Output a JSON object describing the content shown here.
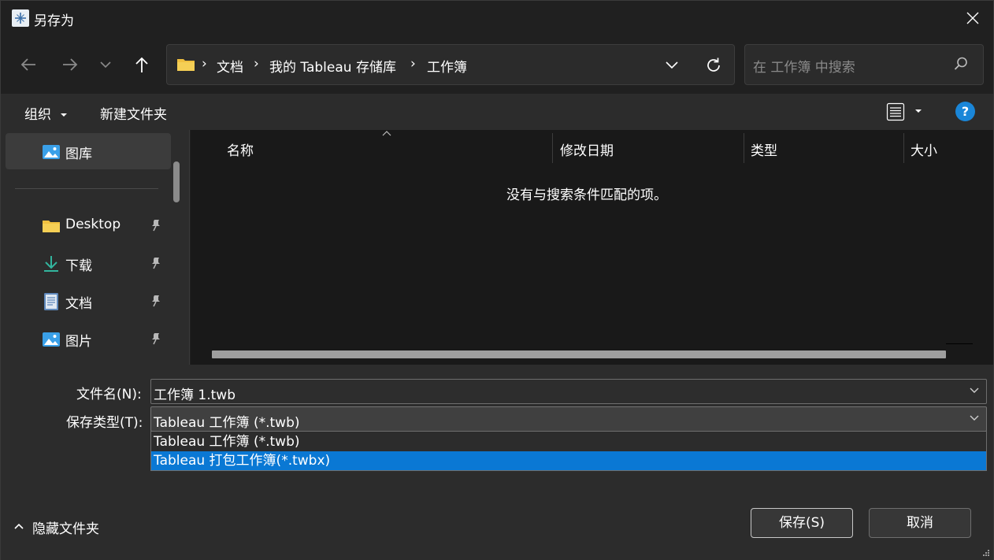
{
  "window": {
    "title": "另存为",
    "close_glyph": "✕"
  },
  "nav": {
    "breadcrumb": [
      "文档",
      "我的 Tableau 存储库",
      "工作簿"
    ],
    "separator": "›",
    "search_placeholder": "在 工作簿 中搜索"
  },
  "toolbar": {
    "organize_label": "组织",
    "new_folder_label": "新建文件夹",
    "help_glyph": "?"
  },
  "sidebar": {
    "items": [
      {
        "label": "图库",
        "icon": "gallery-icon",
        "pinned": false,
        "selected": true
      },
      {
        "label": "Desktop",
        "icon": "folder-icon",
        "pinned": true
      },
      {
        "label": "下载",
        "icon": "download-icon",
        "pinned": true
      },
      {
        "label": "文档",
        "icon": "document-icon",
        "pinned": true
      },
      {
        "label": "图片",
        "icon": "pictures-icon",
        "pinned": true
      }
    ]
  },
  "filelist": {
    "columns": [
      "名称",
      "修改日期",
      "类型",
      "大小"
    ],
    "empty_message": "没有与搜索条件匹配的项。"
  },
  "form": {
    "filename_label": "文件名(N):",
    "filename_value": "工作簿 1.twb",
    "filetype_label": "保存类型(T):",
    "filetype_value": "Tableau 工作簿 (*.twb)",
    "filetype_options": [
      "Tableau 工作簿 (*.twb)",
      "Tableau 打包工作簿(*.twbx)"
    ],
    "highlighted_option": 1
  },
  "footer": {
    "hide_folders_label": "隐藏文件夹",
    "save_label": "保存(S)",
    "cancel_label": "取消"
  },
  "colors": {
    "accent": "#0a78d4",
    "help": "#1a86d8",
    "folder": "#f0c040"
  }
}
